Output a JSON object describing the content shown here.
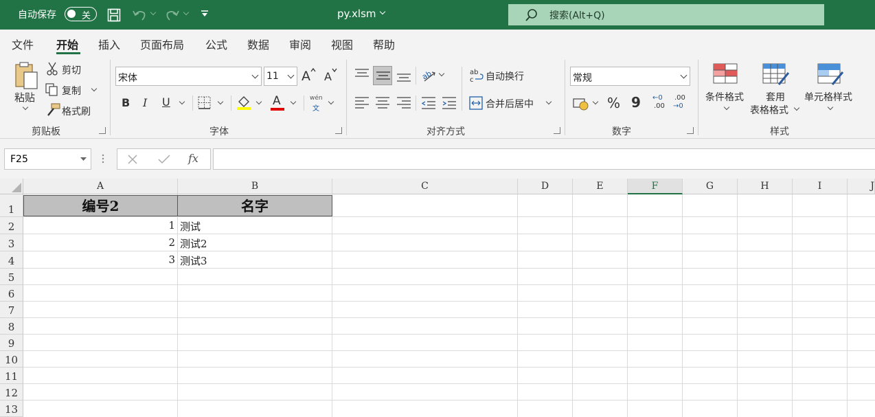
{
  "titlebar": {
    "autosave_label": "自动保存",
    "autosave_state": "关",
    "filename": "py.xlsm",
    "search_placeholder": "搜索(Alt+Q)"
  },
  "tabs": [
    "文件",
    "开始",
    "插入",
    "页面布局",
    "公式",
    "数据",
    "审阅",
    "视图",
    "帮助"
  ],
  "active_tab": "开始",
  "ribbon": {
    "clipboard": {
      "paste": "粘贴",
      "cut": "剪切",
      "copy": "复制",
      "format_painter": "格式刷",
      "group": "剪贴板"
    },
    "font": {
      "name": "宋体",
      "size": "11",
      "group": "字体",
      "phonetic_top": "wén",
      "phonetic_bottom": "文",
      "bold": "B",
      "italic": "I",
      "underline": "U",
      "color_letter": "A"
    },
    "alignment": {
      "wrap": "自动换行",
      "merge": "合并后居中",
      "group": "对齐方式"
    },
    "number": {
      "format": "常规",
      "percent": "%",
      "comma": "9",
      "inc_top": "←0",
      "inc_bottom": ".00",
      "dec_top": ".00",
      "dec_bottom": "→0",
      "group": "数字"
    },
    "styles": {
      "conditional": "条件格式",
      "table_line1": "套用",
      "table_line2": "表格格式",
      "cell_styles": "单元格样式",
      "group": "样式"
    }
  },
  "formula_bar": {
    "name_box": "F25",
    "formula": "",
    "fx": "fx"
  },
  "grid": {
    "columns": [
      "A",
      "B",
      "C",
      "D",
      "E",
      "F",
      "G",
      "H",
      "I",
      "J"
    ],
    "selected_column": "F",
    "rows": [
      "1",
      "2",
      "3",
      "4",
      "5",
      "6",
      "7",
      "8",
      "9",
      "10",
      "11",
      "12",
      "13"
    ],
    "header_cells": [
      "编号2",
      "名字"
    ],
    "data": [
      {
        "id": "1",
        "name": "测试"
      },
      {
        "id": "2",
        "name": "测试2"
      },
      {
        "id": "3",
        "name": "测试3"
      }
    ]
  },
  "colors": {
    "excel_green": "#217346",
    "ribbon_bg": "#f3f3f3",
    "header_fill": "#bfbfbf"
  }
}
